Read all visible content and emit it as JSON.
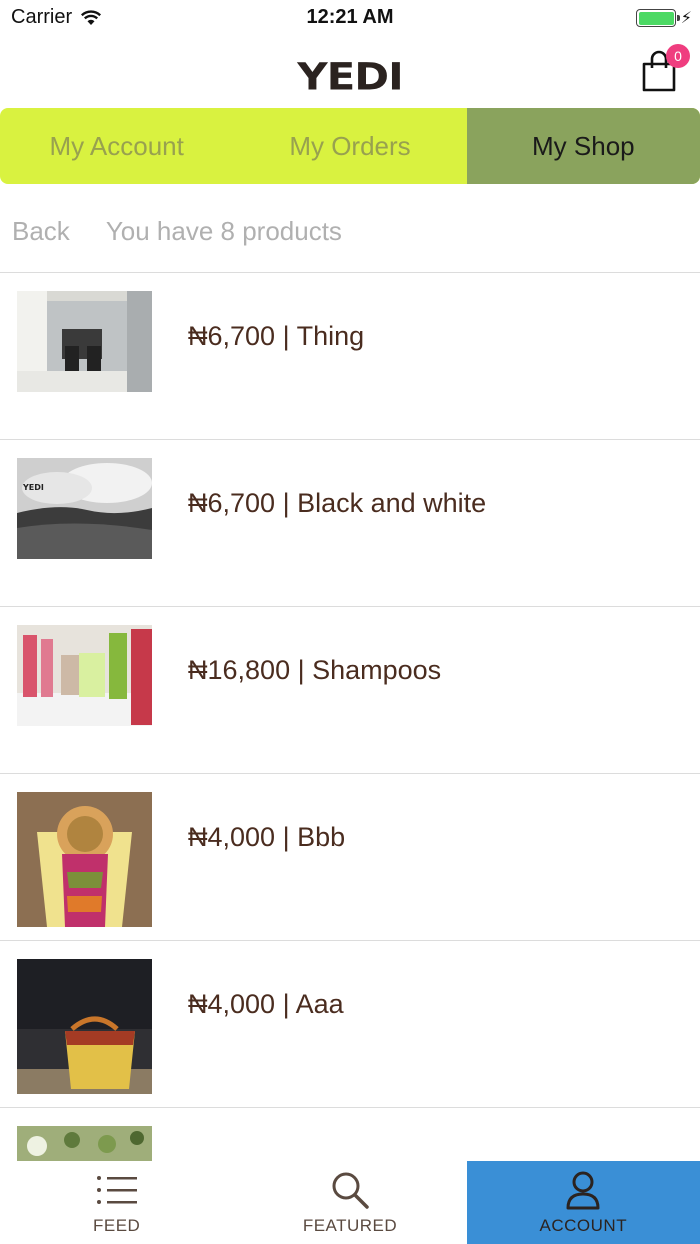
{
  "status": {
    "carrier": "Carrier",
    "time": "12:21 AM"
  },
  "header": {
    "logo": "YEDI",
    "cart_count": "0"
  },
  "tabs": [
    {
      "label": "My Account",
      "active": false
    },
    {
      "label": "My Orders",
      "active": false
    },
    {
      "label": "My Shop",
      "active": true
    }
  ],
  "subheader": {
    "back_label": "Back",
    "count_text": "You have 8 products"
  },
  "products": [
    {
      "label": "₦6,700 | Thing"
    },
    {
      "label": "₦6,700 | Black and white"
    },
    {
      "label": "₦16,800 | Shampoos"
    },
    {
      "label": "₦4,000 | Bbb"
    },
    {
      "label": "₦4,000 | Aaa"
    },
    {
      "label": ""
    }
  ],
  "bottom_nav": [
    {
      "label": "FEED",
      "icon": "list-icon",
      "active": false
    },
    {
      "label": "FEATURED",
      "icon": "search-icon",
      "active": false
    },
    {
      "label": "ACCOUNT",
      "icon": "person-icon",
      "active": true
    }
  ],
  "colors": {
    "tab_bar": "#d9f240",
    "tab_active": "#8aa35d",
    "nav_active": "#3a8fd6",
    "badge": "#ef3d7f",
    "text_brown": "#4a2c1f"
  }
}
